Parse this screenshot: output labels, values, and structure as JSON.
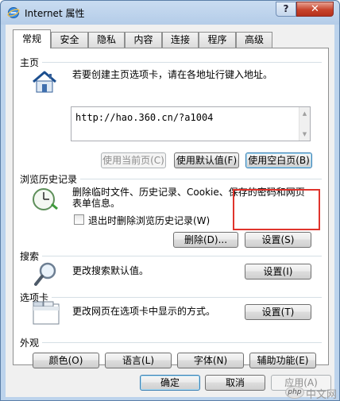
{
  "window": {
    "title": "Internet 属性",
    "help": "?",
    "close": "✕"
  },
  "tabs": [
    {
      "label": "常规",
      "active": true
    },
    {
      "label": "安全"
    },
    {
      "label": "隐私"
    },
    {
      "label": "内容"
    },
    {
      "label": "连接"
    },
    {
      "label": "程序"
    },
    {
      "label": "高级"
    }
  ],
  "home": {
    "heading": "主页",
    "description": "若要创建主页选项卡，请在各地址行键入地址。",
    "url": "http://hao.360.cn/?a1004",
    "use_current": "使用当前页(C)",
    "use_default": "使用默认值(F)",
    "use_blank": "使用空白页(B)"
  },
  "history": {
    "heading": "浏览历史记录",
    "description_line1": "删除临时文件、历史记录、Cookie、保存的密码和网页",
    "description_line2": "表单信息。",
    "delete_on_exit": "退出时删除浏览历史记录(W)",
    "delete_button": "删除(D)...",
    "settings_button": "设置(S)"
  },
  "search": {
    "heading": "搜索",
    "description": "更改搜索默认值。",
    "settings_button": "设置(I)"
  },
  "tabs_section": {
    "heading": "选项卡",
    "description": "更改网页在选项卡中显示的方式。",
    "settings_button": "设置(T)"
  },
  "appearance": {
    "heading": "外观",
    "colors": "颜色(O)",
    "languages": "语言(L)",
    "fonts": "字体(N)",
    "accessibility": "辅助功能(E)"
  },
  "footer": {
    "ok": "确定",
    "cancel": "取消",
    "apply": "应用(A)"
  },
  "watermark": {
    "logo": "php",
    "text": "中文网"
  },
  "colors": {
    "highlight": "#e0342c",
    "title_bar": "#bcd3ec",
    "close_button": "#c7432b"
  }
}
